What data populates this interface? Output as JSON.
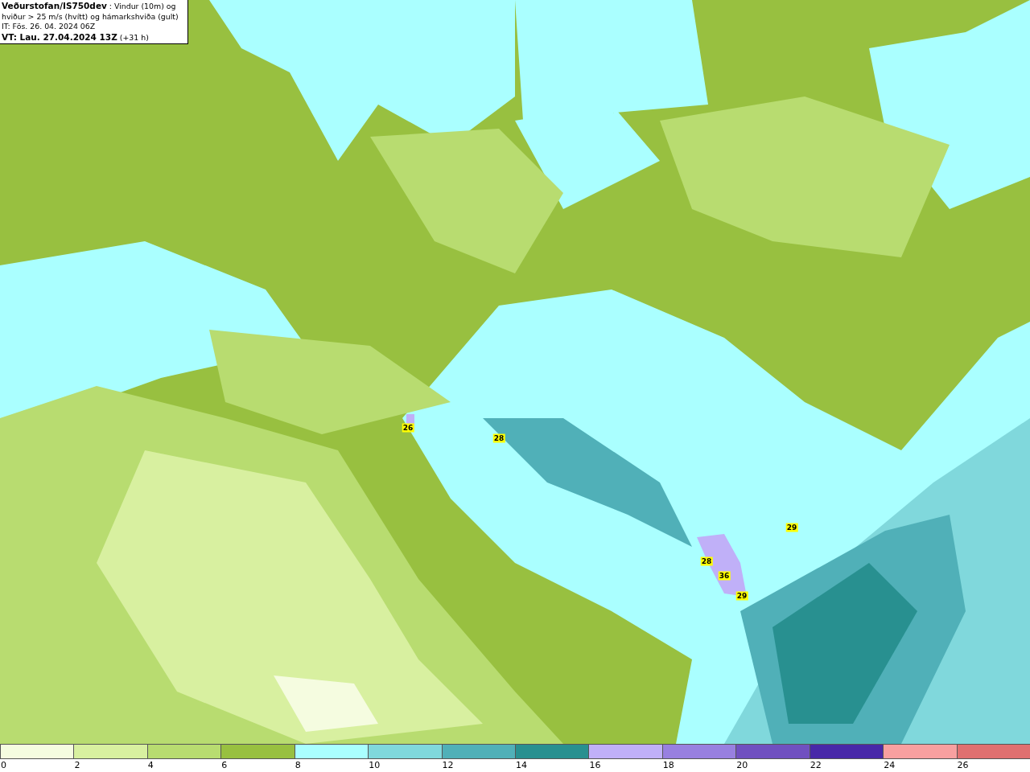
{
  "header": {
    "title": "**Veðurstofan/IS750dev** : Vindur (10m) og hviður > 25 m/s (hvítt) og hámarkshviða (gult)",
    "issue_time": "IT: Fös. 26. 04. 2024 06Z",
    "valid_time": "**VT: Lau. 27.04.2024 13Z** (+31 h)"
  },
  "map": {
    "gust_labels": [
      {
        "text": "26"
      },
      {
        "text": "28"
      },
      {
        "text": "29"
      },
      {
        "text": "28"
      },
      {
        "text": "36"
      },
      {
        "text": "29"
      }
    ]
  },
  "legend": [
    {
      "label": "0",
      "color": "#f5fce0"
    },
    {
      "label": "2",
      "color": "#d8f0a0"
    },
    {
      "label": "4",
      "color": "#b8dc70"
    },
    {
      "label": "6",
      "color": "#98c040"
    },
    {
      "label": "8",
      "color": "#aaffff"
    },
    {
      "label": "10",
      "color": "#80d8dc"
    },
    {
      "label": "12",
      "color": "#50b0b8"
    },
    {
      "label": "14",
      "color": "#289090"
    },
    {
      "label": "16",
      "color": "#c0b0f8"
    },
    {
      "label": "18",
      "color": "#9880e0"
    },
    {
      "label": "20",
      "color": "#7050c0"
    },
    {
      "label": "22",
      "color": "#4828a8"
    },
    {
      "label": "24",
      "color": "#f8a0a0"
    },
    {
      "label": "26",
      "color": "#e07070"
    }
  ]
}
